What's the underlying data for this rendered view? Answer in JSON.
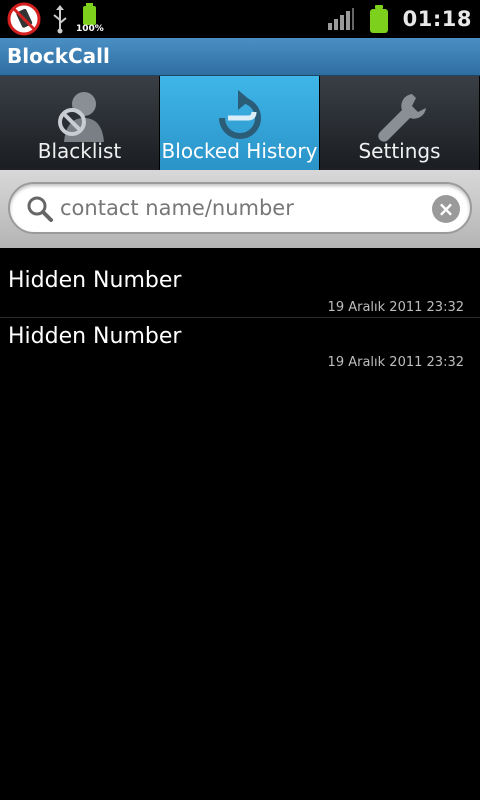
{
  "status_bar": {
    "time": "01:18",
    "battery_small_label": "100%",
    "icons": [
      "blocked-call-icon",
      "usb-icon",
      "battery-icon",
      "signal-icon",
      "battery-icon"
    ]
  },
  "app": {
    "title": "BlockCall"
  },
  "tabs": [
    {
      "label": "Blacklist",
      "icon": "blacklist-icon",
      "active": false
    },
    {
      "label": "Blocked History",
      "icon": "history-icon",
      "active": true
    },
    {
      "label": "Settings",
      "icon": "wrench-icon",
      "active": false
    }
  ],
  "search": {
    "placeholder": "contact name/number"
  },
  "history": [
    {
      "name": "Hidden Number",
      "date": "19 Aralık 2011 23:32"
    },
    {
      "name": "Hidden Number",
      "date": "19 Aralık 2011 23:32"
    }
  ],
  "colors": {
    "titlebar": "#3f83b8",
    "active_tab": "#38a9dc",
    "battery": "#7dd11c"
  }
}
